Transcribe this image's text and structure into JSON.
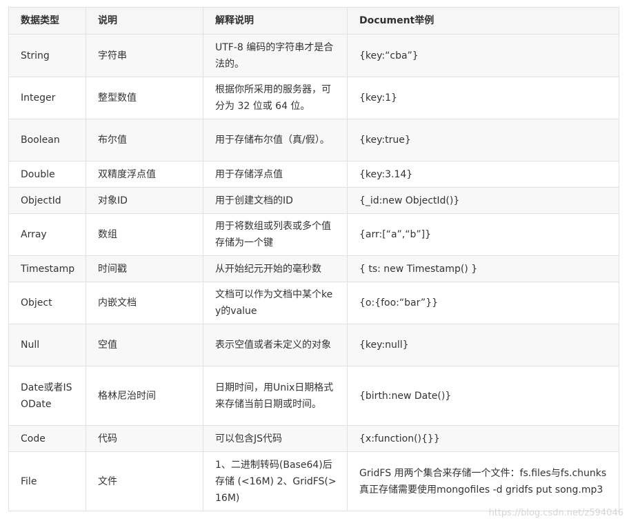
{
  "table": {
    "headers": [
      "数据类型",
      "说明",
      "解释说明",
      "Document举例"
    ],
    "rows": [
      {
        "type": "String",
        "desc": "字符串",
        "explain": "UTF-8 编码的字符串才是合法的。",
        "example": "{key:“cba”}"
      },
      {
        "type": "Integer",
        "desc": "整型数值",
        "explain": "根据你所采用的服务器，可分为 32 位或 64 位。",
        "example": "{key:1}"
      },
      {
        "type": "Boolean",
        "desc": "布尔值",
        "explain": "用于存储布尔值（真/假）。",
        "example": "{key:true}"
      },
      {
        "type": "Double",
        "desc": "双精度浮点值",
        "explain": "用于存储浮点值",
        "example": "{key:3.14}"
      },
      {
        "type": "ObjectId",
        "desc": "对象ID",
        "explain": "用于创建文档的ID",
        "example": "{_id:new ObjectId()}"
      },
      {
        "type": "Array",
        "desc": "数组",
        "explain": "用于将数组或列表或多个值存储为一个键",
        "example": "{arr:[“a”,“b”]}"
      },
      {
        "type": "Timestamp",
        "desc": "时间戳",
        "explain": "从开始纪元开始的毫秒数",
        "example": "{ ts: new Timestamp() }"
      },
      {
        "type": "Object",
        "desc": "内嵌文档",
        "explain": "文档可以作为文档中某个key的value",
        "example": "{o:{foo:“bar”}}"
      },
      {
        "type": "Null",
        "desc": "空值",
        "explain": "表示空值或者未定义的对象",
        "example": "{key:null}"
      },
      {
        "type": "Date或者ISODate",
        "desc": "格林尼治时间",
        "explain": "日期时间，用Unix日期格式来存储当前日期或时间。",
        "example": "{birth:new Date()}"
      },
      {
        "type": "Code",
        "desc": "代码",
        "explain": "可以包含JS代码",
        "example": "{x:function(){}}"
      },
      {
        "type": "File",
        "desc": "文件",
        "explain": "1、二进制转码(Base64)后存储 (<16M) 2、GridFS(>16M)",
        "example": "GridFS 用两个集合来存储一个文件：fs.files与fs.chunks 真正存储需要使用mongofiles -d gridfs put song.mp3"
      }
    ]
  },
  "watermark": "https://blog.csdn.net/z594046"
}
